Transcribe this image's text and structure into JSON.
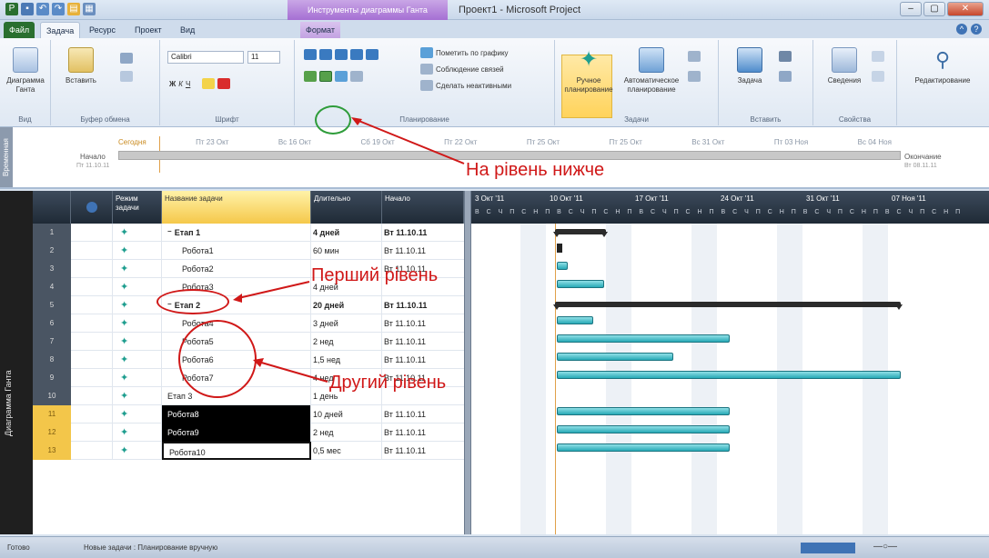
{
  "window": {
    "title": "Проект1 - Microsoft Project",
    "context_tab": "Инструменты диаграммы Ганта"
  },
  "tabs": [
    "Файл",
    "Задача",
    "Ресурс",
    "Проект",
    "Вид",
    "Формат"
  ],
  "ribbon": {
    "groups": {
      "view": {
        "label": "Вид",
        "button": "Диаграмма Ганта"
      },
      "clipboard": {
        "label": "Буфер обмена",
        "button": "Вставить"
      },
      "font": {
        "label": "Шрифт",
        "font_name": "Calibri",
        "font_size": "11"
      },
      "schedule": {
        "label": "Планирование",
        "mark_on_track": "Пометить по графику",
        "respect_links": "Соблюдение связей",
        "inactivate": "Сделать неактивными"
      },
      "tasks": {
        "label": "Задачи",
        "manual": "Ручное планирование",
        "auto": "Автоматическое планирование"
      },
      "insert": {
        "label": "Вставить",
        "task": "Задача"
      },
      "properties": {
        "label": "Свойства",
        "details": "Сведения"
      },
      "editing": {
        "label": "Редактирование"
      }
    }
  },
  "timeline": {
    "side_label": "Временная",
    "today_label": "Сегодня",
    "dates": [
      "Пт 23 Окт",
      "Вс 16 Окт",
      "Сб 19 Окт",
      "Пт 22 Окт",
      "Пт 25 Окт",
      "Пт 25 Окт",
      "Вс 31 Окт",
      "Пт 03 Ноя",
      "Вс 04 Ноя"
    ],
    "start_label": "Начало",
    "start_date": "Пт 11.10.11",
    "end_label": "Окончание",
    "end_date": "Вт 08.11.11"
  },
  "grid": {
    "side_label": "Диаграмма Ганта",
    "headers": {
      "mode": "Режим задачи",
      "name": "Название задачи",
      "duration": "Длительно",
      "start": "Начало"
    },
    "rows": [
      {
        "num": "1",
        "name": "Етап 1",
        "duration": "4 дней",
        "start": "Вт 11.10.11",
        "bold": true,
        "indent": 1,
        "selected": false
      },
      {
        "num": "2",
        "name": "Робота1",
        "duration": "60 мин",
        "start": "Вт 11.10.11",
        "bold": false,
        "indent": 2,
        "selected": false
      },
      {
        "num": "3",
        "name": "Робота2",
        "duration": "",
        "start": "Вт 11.10.11",
        "bold": false,
        "indent": 2,
        "selected": false
      },
      {
        "num": "4",
        "name": "Робота3",
        "duration": "4 дней",
        "start": "",
        "bold": false,
        "indent": 2,
        "selected": false
      },
      {
        "num": "5",
        "name": "Етап 2",
        "duration": "20 дней",
        "start": "Вт 11.10.11",
        "bold": true,
        "indent": 1,
        "selected": false
      },
      {
        "num": "6",
        "name": "Робота4",
        "duration": "3 дней",
        "start": "Вт 11.10.11",
        "bold": false,
        "indent": 2,
        "selected": false
      },
      {
        "num": "7",
        "name": "Робота5",
        "duration": "2 нед",
        "start": "Вт 11.10.11",
        "bold": false,
        "indent": 2,
        "selected": false
      },
      {
        "num": "8",
        "name": "Робота6",
        "duration": "1,5 нед",
        "start": "Вт 11.10.11",
        "bold": false,
        "indent": 2,
        "selected": false
      },
      {
        "num": "9",
        "name": "Робота7",
        "duration": "4 нед",
        "start": "Вт 11.10.11",
        "bold": false,
        "indent": 2,
        "selected": false
      },
      {
        "num": "10",
        "name": "Етап 3",
        "duration": "1 день",
        "start": "",
        "bold": false,
        "indent": 1,
        "selected": false
      },
      {
        "num": "11",
        "name": "Робота8",
        "duration": "10 дней",
        "start": "Вт 11.10.11",
        "bold": false,
        "indent": 1,
        "selected": true
      },
      {
        "num": "12",
        "name": "Робота9",
        "duration": "2 нед",
        "start": "Вт 11.10.11",
        "bold": false,
        "indent": 1,
        "selected": true
      },
      {
        "num": "13",
        "name": "Робота10",
        "duration": "0,5 мес",
        "start": "Вт 11.10.11",
        "bold": false,
        "indent": 1,
        "selected": true
      }
    ]
  },
  "chart": {
    "weeks": [
      "3 Окт '11",
      "10 Окт '11",
      "17 Окт '11",
      "24 Окт '11",
      "31 Окт '11",
      "07 Ноя '11"
    ],
    "day_letters": "В С Ч П С Н П В С Ч П С Н П В С Ч П С Н П В С Ч П С Н П В С Ч П С Н П В С Ч П С Н П"
  },
  "status": {
    "ready": "Готово",
    "new_tasks": "Новые задачи : Планирование вручную"
  },
  "annotations": {
    "level_down": "На рівень нижче",
    "first_level": "Перший рівень",
    "second_level": "Другий рівень"
  }
}
